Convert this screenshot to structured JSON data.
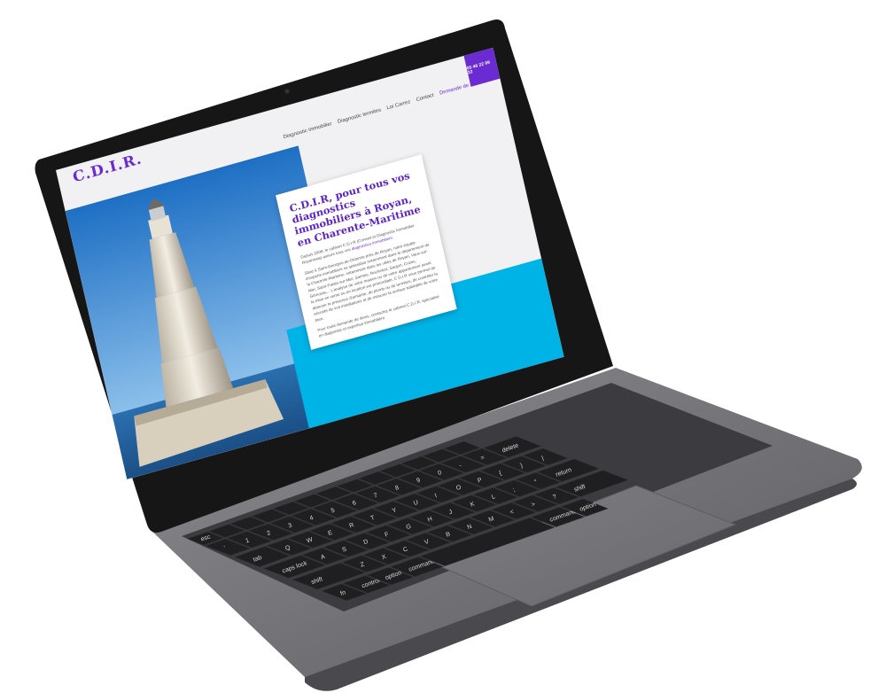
{
  "site": {
    "logo": "C.D.I.R.",
    "nav": [
      "Diagnostic immobilier",
      "Diagnostic termites",
      "Loi Carrez",
      "Contact",
      "Demande de devis"
    ],
    "phone": "05 46 22 99 22",
    "heading": "C.D.I.R, pour tous vos diagnostics immobiliers à Royan, en Charente-Maritime",
    "para1_a": "Depuis 2008, le cabinet C.D.I.R (Conseil et Diagnostic Immobilier Royannais) assure tous vos",
    "para1_link": "diagnostics immobiliers.",
    "para2": "Situé à Saint-Georges-de-Didonne près de Royan, notre équipe d'experts immobiliers se spécialise notamment dans le département de la Charente-Maritime, notamment dans les villes de Royan, Vaux-sur-Mer, Saint-Palais-sur-Mer, Saintes, Rochefort, Saujon, Cozes, Gémozac... L'analyse de votre maison ou de votre appartement avant la mise en vente ou en location est primordiale. C.D.I.R vous permet de détecter la présence d'amiante, de plomb ou de termites, de contrôler la sécurité de vos installations et de mesurer la surface habitable de votre bien.",
    "para3": "Pour toute demande de devis, contactez le cabinet C.D.I.R, spécialisé en diagnostic et expertise immobilière."
  },
  "keyboard": {
    "row_function": [
      "esc",
      "",
      "",
      "",
      "",
      "",
      "",
      "",
      "",
      "",
      "",
      "",
      ""
    ],
    "row_numbers": [
      "`",
      "1",
      "2",
      "3",
      "4",
      "5",
      "6",
      "7",
      "8",
      "9",
      "0",
      "-",
      "=",
      "delete"
    ],
    "row_top": [
      "tab",
      "Q",
      "W",
      "E",
      "R",
      "T",
      "Y",
      "U",
      "I",
      "O",
      "P",
      "{",
      "}",
      "|"
    ],
    "row_home": [
      "caps lock",
      "A",
      "S",
      "D",
      "F",
      "G",
      "H",
      "J",
      "K",
      "L",
      ";",
      "\"",
      "return"
    ],
    "row_bottom": [
      "shift",
      "Z",
      "X",
      "C",
      "V",
      "B",
      "N",
      "M",
      "<",
      ">",
      "?",
      "shift"
    ],
    "row_mods": [
      "fn",
      "control",
      "option",
      "command",
      "",
      "command",
      "option"
    ]
  },
  "colors": {
    "brand_purple": "#6a2bd3",
    "accent_cyan": "#00b3e6",
    "laptop_body": "#76767a",
    "bezel": "#161616"
  }
}
